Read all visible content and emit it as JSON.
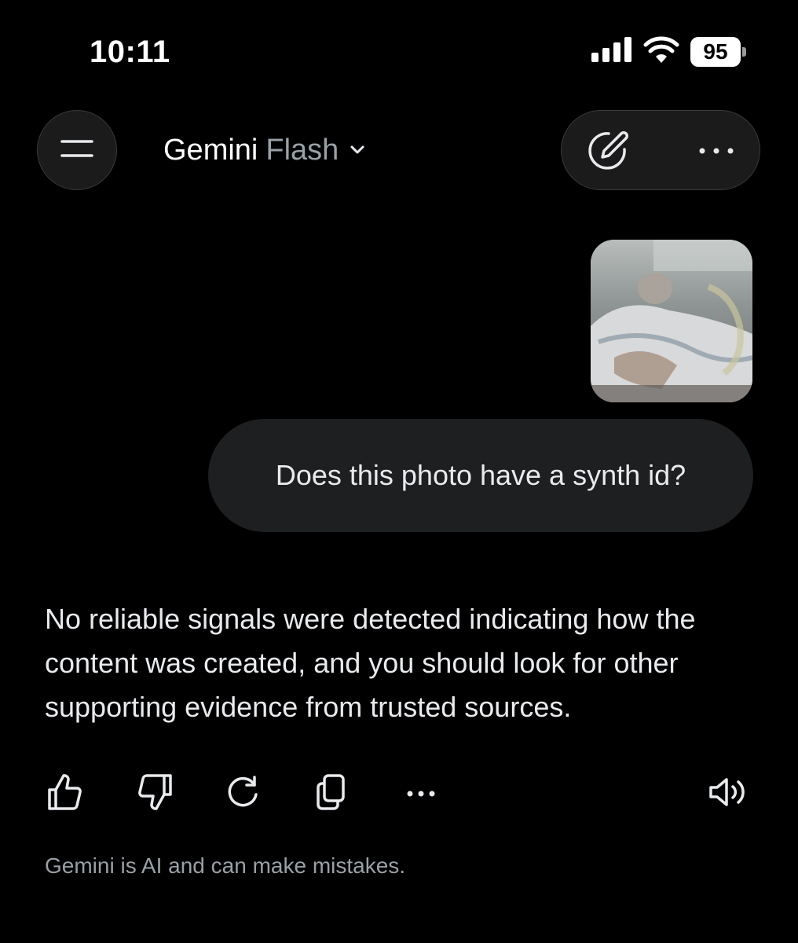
{
  "status_bar": {
    "time": "10:11",
    "battery": "95",
    "icons": [
      "signal-icon",
      "wifi-icon",
      "battery-icon"
    ]
  },
  "header": {
    "title": "Gemini",
    "model": "Flash",
    "icons": [
      "menu-icon",
      "chevron-down-icon",
      "new-chat-icon",
      "more-icon"
    ]
  },
  "conversation": {
    "user_message": "Does this photo have a synth id?",
    "response": "No reliable signals were detected indicating how the content was created, and you should look for other supporting evidence from trusted sources."
  },
  "response_actions": {
    "icons": [
      "thumbs-up-icon",
      "thumbs-down-icon",
      "regenerate-icon",
      "copy-icon",
      "more-icon",
      "speaker-icon"
    ]
  },
  "footer": {
    "disclaimer": "Gemini is AI and can make mistakes."
  },
  "colors": {
    "background": "#000000",
    "bubble": "#1e1f20",
    "muted_text": "#9aa0a6",
    "text": "#e8eaed"
  }
}
